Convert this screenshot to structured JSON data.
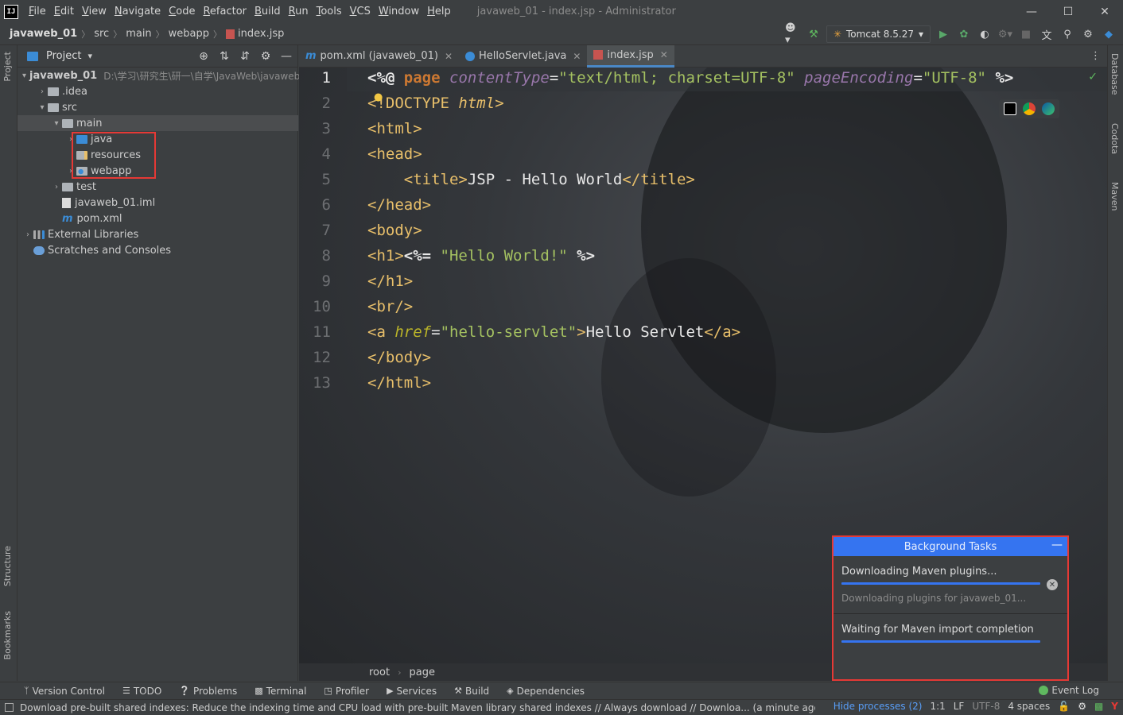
{
  "app": {
    "window_title": "javaweb_01 - index.jsp - Administrator",
    "logo": "IJ"
  },
  "menu": [
    "File",
    "Edit",
    "View",
    "Navigate",
    "Code",
    "Refactor",
    "Build",
    "Run",
    "Tools",
    "VCS",
    "Window",
    "Help"
  ],
  "navbar": {
    "crumbs": [
      "javaweb_01",
      "src",
      "main",
      "webapp",
      "index.jsp"
    ],
    "run_config": "Tomcat 8.5.27"
  },
  "project": {
    "title": "Project",
    "tree": [
      {
        "label": "javaweb_01",
        "path": "D:\\学习\\研究生\\研一\\自学\\JavaWeb\\javaweb",
        "indent": 0,
        "arrow": "▾",
        "icon": "folder"
      },
      {
        "label": ".idea",
        "indent": 1,
        "arrow": "›",
        "icon": "folder"
      },
      {
        "label": "src",
        "indent": 1,
        "arrow": "▾",
        "icon": "folder"
      },
      {
        "label": "main",
        "indent": 2,
        "arrow": "▾",
        "icon": "folder"
      },
      {
        "label": "java",
        "indent": 3,
        "arrow": "›",
        "icon": "folder-blue"
      },
      {
        "label": "resources",
        "indent": 3,
        "arrow": "",
        "icon": "folder-res"
      },
      {
        "label": "webapp",
        "indent": 3,
        "arrow": "›",
        "icon": "folder-web"
      },
      {
        "label": "test",
        "indent": 2,
        "arrow": "›",
        "icon": "folder"
      },
      {
        "label": "javaweb_01.iml",
        "indent": 2,
        "arrow": "",
        "icon": "file"
      },
      {
        "label": "pom.xml",
        "indent": 2,
        "arrow": "",
        "icon": "maven"
      },
      {
        "label": "External Libraries",
        "indent": 0,
        "arrow": "›",
        "icon": "libs"
      },
      {
        "label": "Scratches and Consoles",
        "indent": 0,
        "arrow": "",
        "icon": "scratch"
      }
    ]
  },
  "tabs": [
    {
      "label": "pom.xml (javaweb_01)",
      "icon": "maven",
      "active": false
    },
    {
      "label": "HelloServlet.java",
      "icon": "class",
      "active": false
    },
    {
      "label": "index.jsp",
      "icon": "jsp",
      "active": true
    }
  ],
  "editor": {
    "line_numbers": [
      "1",
      "2",
      "3",
      "4",
      "5",
      "6",
      "7",
      "8",
      "9",
      "10",
      "11",
      "12",
      "13"
    ],
    "breadcrumb": [
      "root",
      "page"
    ]
  },
  "stripes": {
    "left": [
      "Project",
      "Structure",
      "Bookmarks"
    ],
    "right": [
      "Database",
      "Codota",
      "Maven"
    ]
  },
  "background_tasks": {
    "title": "Background Tasks",
    "task1_title": "Downloading Maven plugins...",
    "task1_sub": "Downloading plugins for javaweb_01...",
    "task2_title": "Waiting for Maven import completion"
  },
  "bottom_tools": [
    "Version Control",
    "TODO",
    "Problems",
    "Terminal",
    "Profiler",
    "Services",
    "Build",
    "Dependencies"
  ],
  "event_log": "Event Log",
  "status": {
    "message": "Download pre-built shared indexes: Reduce the indexing time and CPU load with pre-built Maven library shared indexes // Always download // Downloa... (a minute ago)",
    "hide_processes": "Hide processes (2)",
    "position": "1:1",
    "line_sep": "LF",
    "encoding": "UTF-8",
    "indent": "4 spaces"
  },
  "colors": {
    "accent": "#3574f0",
    "highlight_box": "#e53935",
    "tag": "#e8bf6a",
    "string": "#a5c261"
  }
}
